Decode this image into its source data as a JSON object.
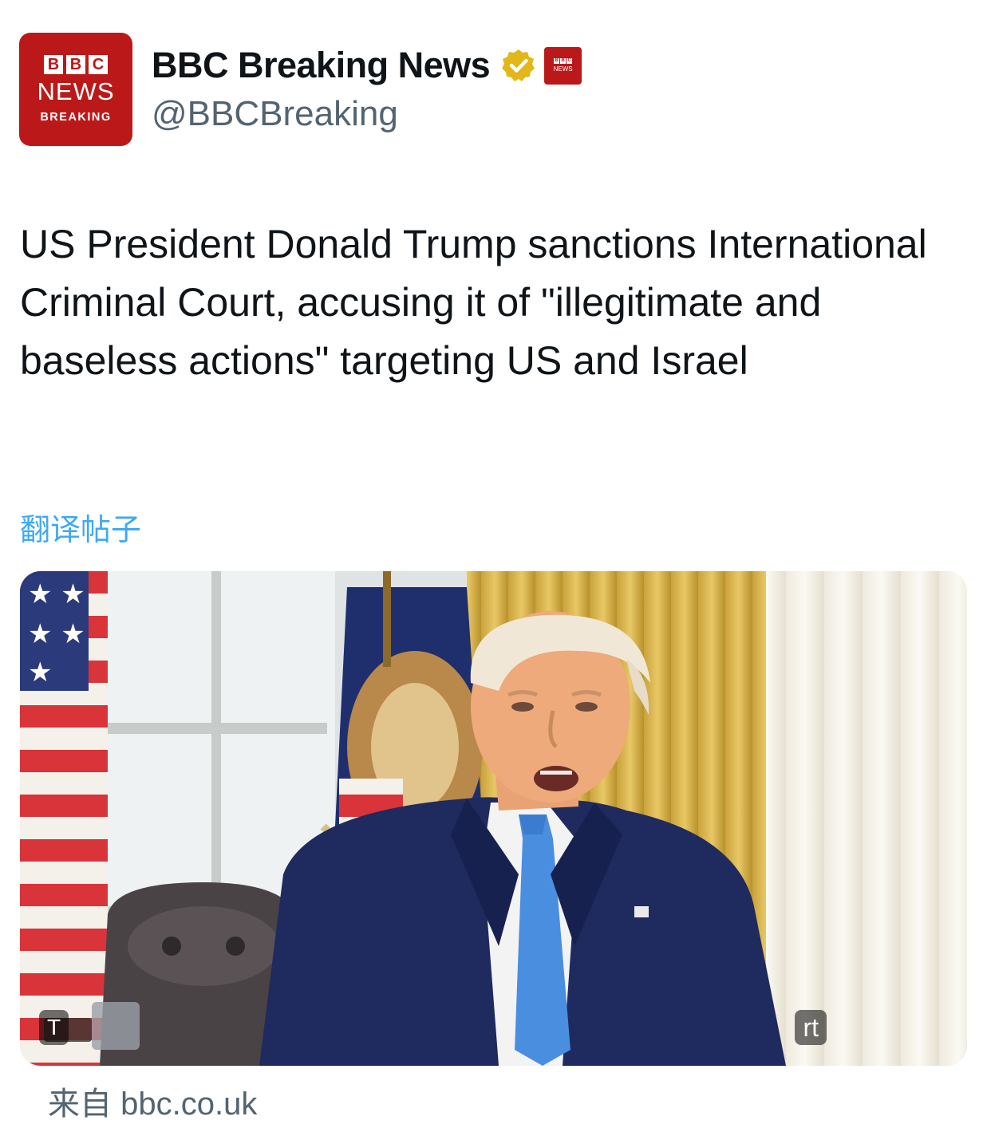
{
  "author": {
    "avatar_blocks": [
      "B",
      "B",
      "C"
    ],
    "avatar_line1": "NEWS",
    "avatar_line2": "BREAKING",
    "display_name": "BBC Breaking News",
    "handle": "@BBCBreaking",
    "verified_icon": "gold-verified-badge",
    "affiliate_icon": "bbc-news-affiliate-badge"
  },
  "post": {
    "text": "US President Donald Trump sanctions International Criminal Court, accusing it of \"illegitimate and baseless actions\" targeting US and Israel",
    "translate_label": "翻译帖子"
  },
  "media": {
    "badge_left": "T",
    "badge_right": "rt"
  },
  "source": {
    "prefix": "来自",
    "domain": "bbc.co.uk"
  },
  "colors": {
    "bbc_red": "#bb1919",
    "link_blue": "#1d9bf0",
    "verified_gold": "#e2b719",
    "secondary_text": "#536471"
  }
}
